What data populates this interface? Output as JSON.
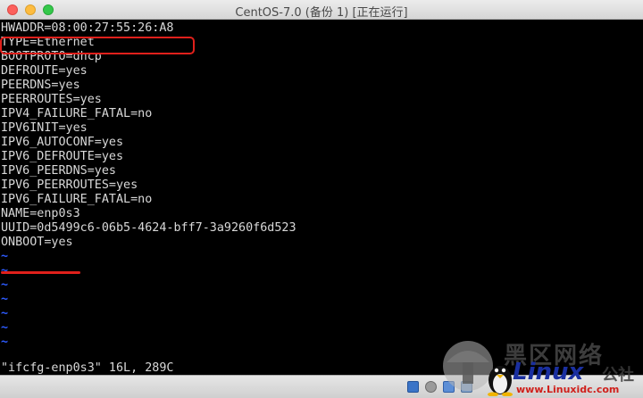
{
  "window": {
    "title": "CentOS-7.0 (备份 1) [正在运行]"
  },
  "terminal": {
    "lines": [
      "HWADDR=08:00:27:55:26:A8",
      "TYPE=Ethernet",
      "BOOTPROTO=dhcp",
      "DEFROUTE=yes",
      "PEERDNS=yes",
      "PEERROUTES=yes",
      "IPV4_FAILURE_FATAL=no",
      "IPV6INIT=yes",
      "IPV6_AUTOCONF=yes",
      "IPV6_DEFROUTE=yes",
      "IPV6_PEERDNS=yes",
      "IPV6_PEERROUTES=yes",
      "IPV6_FAILURE_FATAL=no",
      "NAME=enp0s3",
      "UUID=0d5499c6-06b5-4624-bff7-3a9260f6d523",
      "ONBOOT=yes"
    ],
    "tilde": "~",
    "status_line": "\"ifcfg-enp0s3\" 16L, 289C"
  },
  "watermark": {
    "cn_text": "黑区网络",
    "linux_text": "Linux",
    "she_text": "公社",
    "url_text": "www.Linuxidc.com"
  },
  "colors": {
    "highlight": "#e0201b",
    "terminal_bg": "#000000",
    "terminal_fg": "#d8d8d8",
    "tilde": "#2d5bff"
  }
}
